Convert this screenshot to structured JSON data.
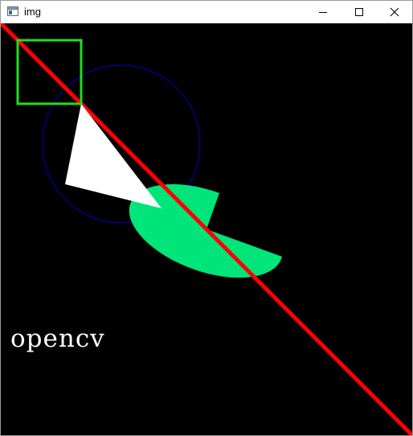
{
  "window": {
    "title": "img",
    "controls": {
      "minimize_icon": "minimize-icon",
      "maximize_icon": "maximize-icon",
      "close_icon": "close-icon"
    }
  },
  "canvas": {
    "background": "#000000",
    "text": "opencv",
    "text_color": "#ffffff",
    "colors": {
      "line": "#ff0000",
      "rectangle": "#22dd22",
      "circle": "#0000cc",
      "triangle": "#ffffff",
      "ellipse_sector": "#00e57a"
    }
  }
}
